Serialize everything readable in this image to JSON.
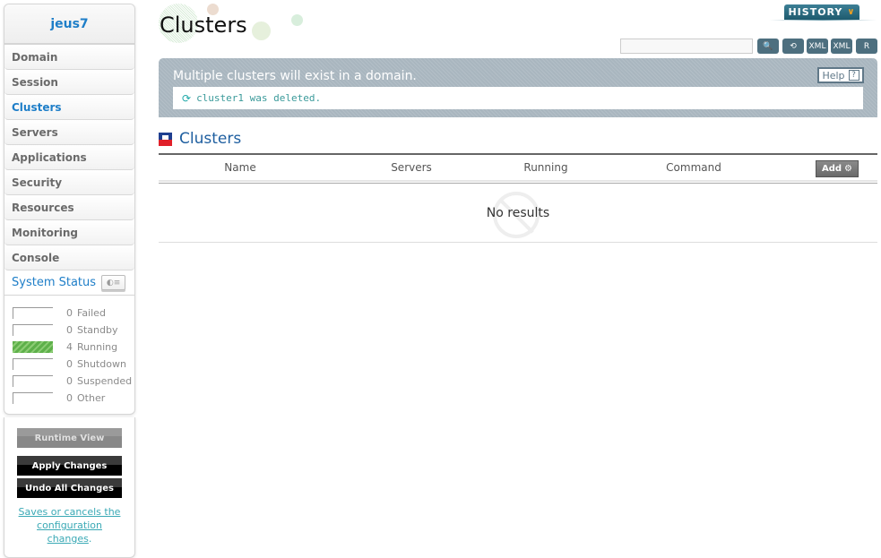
{
  "sidebar": {
    "domain_name": "jeus7",
    "nav": [
      {
        "label": "Domain",
        "active": false
      },
      {
        "label": "Session",
        "active": false
      },
      {
        "label": "Clusters",
        "active": true
      },
      {
        "label": "Servers",
        "active": false
      },
      {
        "label": "Applications",
        "active": false
      },
      {
        "label": "Security",
        "active": false
      },
      {
        "label": "Resources",
        "active": false
      },
      {
        "label": "Monitoring",
        "active": false
      },
      {
        "label": "Console",
        "active": false
      }
    ],
    "system_status": {
      "title": "System Status",
      "rows": [
        {
          "count": "0",
          "label": "Failed"
        },
        {
          "count": "0",
          "label": "Standby"
        },
        {
          "count": "4",
          "label": "Running"
        },
        {
          "count": "0",
          "label": "Shutdown"
        },
        {
          "count": "0",
          "label": "Suspended"
        },
        {
          "count": "0",
          "label": "Other"
        }
      ]
    },
    "buttons": {
      "runtime_view": "Runtime View",
      "apply_changes": "Apply Changes",
      "undo_all_changes": "Undo All Changes"
    },
    "help_text": {
      "link": "Saves or cancels the configuration changes",
      "suffix": "."
    }
  },
  "header": {
    "title": "Clusters",
    "history_label": "HISTORY",
    "search_placeholder": "",
    "toolbar": [
      {
        "icon": "search-icon",
        "glyph": "🔍"
      },
      {
        "icon": "refresh-icon",
        "glyph": "⟲"
      },
      {
        "icon": "xml-export-icon",
        "glyph": "XML"
      },
      {
        "icon": "xml-import-icon",
        "glyph": "XML"
      },
      {
        "icon": "report-icon",
        "glyph": "R"
      }
    ]
  },
  "info": {
    "description": "Multiple clusters will exist in a domain.",
    "help_label": "Help",
    "help_glyph": "?",
    "message": "cluster1 was deleted.",
    "message_glyph": "⟳"
  },
  "section": {
    "title": "Clusters",
    "columns": [
      "Name",
      "Servers",
      "Running",
      "Command"
    ],
    "add_label": "Add",
    "empty_text": "No results"
  }
}
